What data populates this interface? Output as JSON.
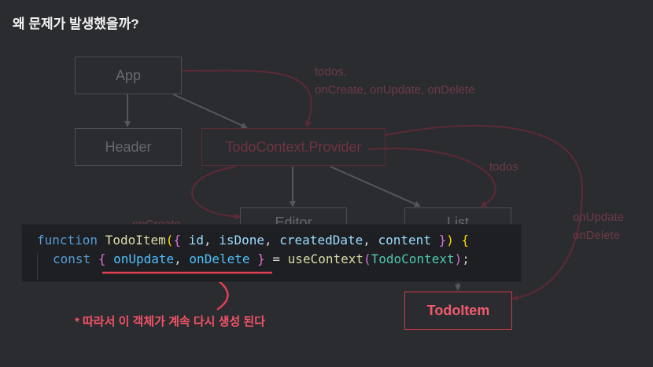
{
  "page": {
    "title": "왜 문제가 발생했을까?"
  },
  "nodes": {
    "app": "App",
    "header": "Header",
    "provider": "TodoContext.Provider",
    "editor": "Editor",
    "list": "List",
    "todoitem": "TodoItem"
  },
  "edge_labels": {
    "app_to_provider": "todos,\nonCreate, onUpdate, onDelete",
    "provider_to_list": "todos",
    "provider_to_editor": "onCreate",
    "provider_to_todoitem": "onUpdate\nonDelete"
  },
  "code": {
    "line1": {
      "keyword": "function",
      "name": "TodoItem",
      "params": [
        "id",
        "isDone",
        "createdDate",
        "content"
      ]
    },
    "line2": {
      "keyword": "const",
      "vars": [
        "onUpdate",
        "onDelete"
      ],
      "call": "useContext",
      "arg": "TodoContext"
    }
  },
  "annotation": "* 따라서 이 객체가 계속 다시 생성 된다",
  "colors": {
    "background": "#2b2c30",
    "accent": "#ef5b6d",
    "dim_node": "#66676c",
    "dim_context": "#6e3440"
  }
}
